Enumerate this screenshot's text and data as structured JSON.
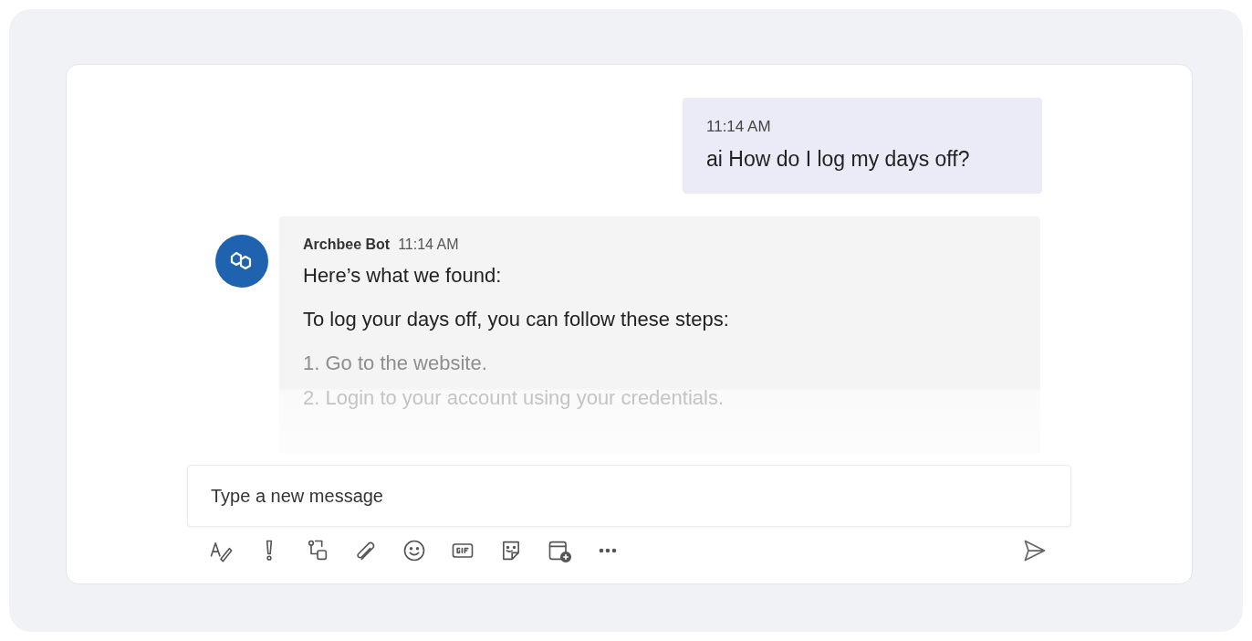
{
  "messages": [
    {
      "kind": "sent",
      "time": "11:14 AM",
      "text": "ai How do I log my days off?"
    },
    {
      "kind": "received",
      "sender": "Archbee Bot",
      "time": "11:14 AM",
      "paragraphs": [
        "Here’s what we found:",
        "To log your days off, you can follow these steps:"
      ],
      "steps": [
        "1. Go to the website.",
        "2. Login to your account using your credentials."
      ]
    }
  ],
  "composer": {
    "placeholder": "Type a new message"
  }
}
